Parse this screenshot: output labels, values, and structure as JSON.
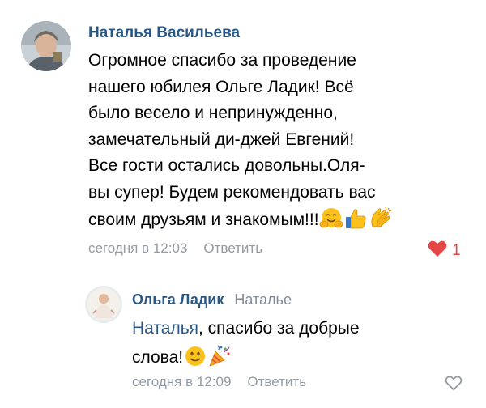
{
  "comment": {
    "author": "Наталья Васильева",
    "lines": [
      "Огромное спасибо за проведение",
      "нашего юбилея Ольге Ладик! Всё",
      "было весело и непринужденно,",
      "замечательный ди-джей Евгений!",
      "Все гости остались довольны.Оля-",
      "вы супер! Будем рекомендовать вас",
      "своим друзьям и знакомым!!!"
    ],
    "emojis": [
      "hugging-face-emoji",
      "thumbs-up-emoji",
      "clapping-hands-emoji"
    ],
    "time": "сегодня в 12:03",
    "reply_label": "Ответить",
    "likes": "1",
    "liked": true,
    "like_color": "#e64646"
  },
  "reply": {
    "author": "Ольга Ладик",
    "addressee": "Наталье",
    "mention": "Наталья",
    "line1_rest": ", спасибо за добрые",
    "line2": "слова!",
    "emojis": [
      "slightly-smiling-face-emoji",
      "party-popper-emoji"
    ],
    "time": "сегодня в 12:09",
    "reply_label": "Ответить",
    "liked": false
  },
  "colors": {
    "link": "#2a5885",
    "meta": "#939ba3",
    "like_active": "#e64646"
  }
}
